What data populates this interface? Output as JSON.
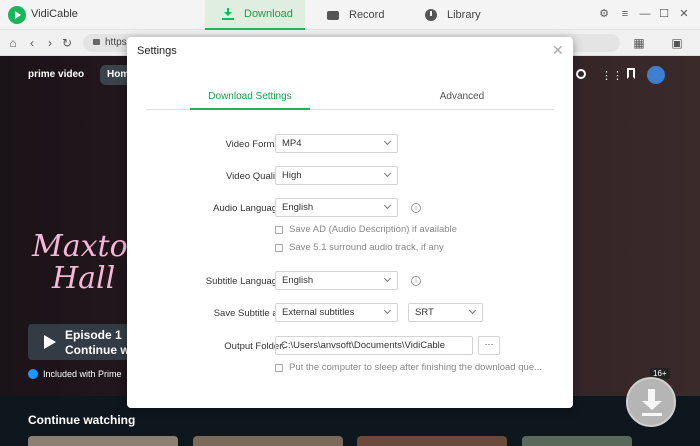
{
  "app": {
    "name": "VidiCable",
    "tabs": [
      {
        "label": "Download",
        "icon": "download-icon"
      },
      {
        "label": "Record",
        "icon": "record-icon"
      },
      {
        "label": "Library",
        "icon": "library-icon"
      }
    ],
    "accent_color": "#1bb55c"
  },
  "browser": {
    "url": "https"
  },
  "background": {
    "logo": "prime video",
    "home_tab": "Hom",
    "show_title_line1": "Maxton",
    "show_title_line2": "Hall",
    "episode_line1": "Episode 1",
    "episode_line2": "Continue wa",
    "prime_label": "Included with Prime",
    "continue_watching": "Continue watching",
    "age_badge": "16+"
  },
  "settings": {
    "title": "Settings",
    "tabs": [
      "Download Settings",
      "Advanced"
    ],
    "video_format": {
      "label": "Video Format:",
      "value": "MP4"
    },
    "video_quality": {
      "label": "Video Quality:",
      "value": "High"
    },
    "audio_language": {
      "label": "Audio Language:",
      "value": "English"
    },
    "save_ad": "Save AD (Audio Description) if available",
    "save_51": "Save 5.1 surround audio track, if any",
    "subtitle_language": {
      "label": "Subtitle Language:",
      "value": "English"
    },
    "save_subtitle": {
      "label": "Save Subtitle as:",
      "value": "External subtitles",
      "format": "SRT"
    },
    "output_folder": {
      "label": "Output Folder:",
      "value": "C:\\Users\\anvsoft\\Documents\\VidiCable",
      "browse": "···"
    },
    "sleep": "Put the computer to sleep after finishing the download que..."
  }
}
